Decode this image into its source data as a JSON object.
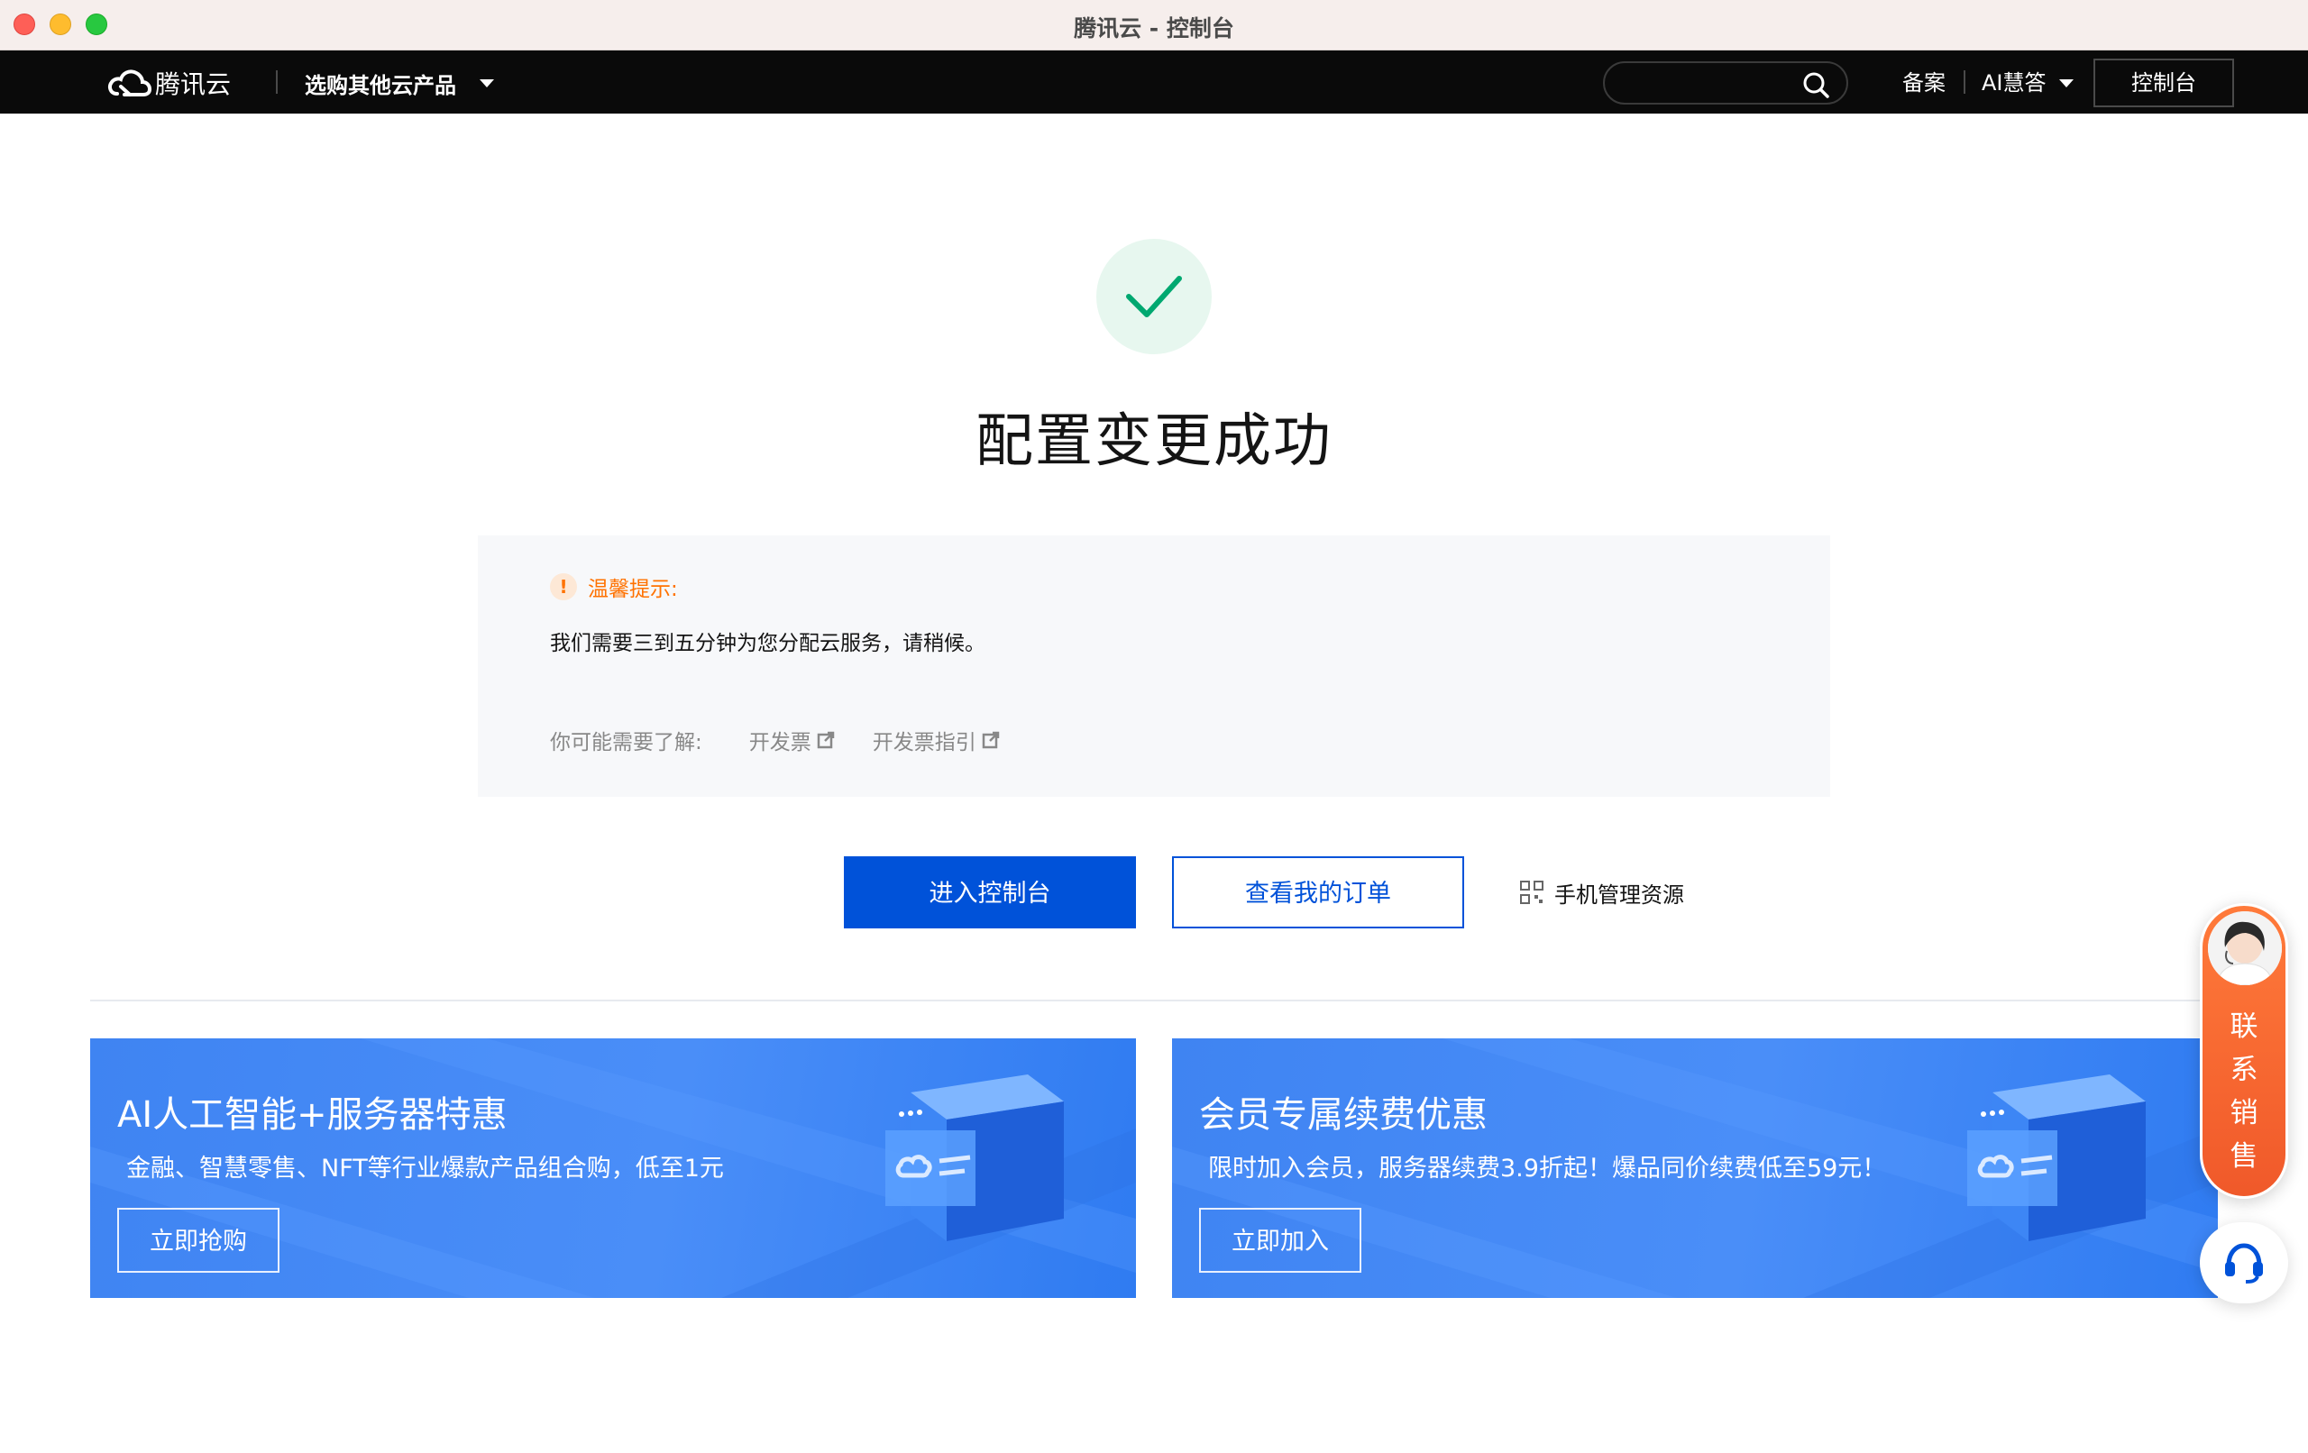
{
  "window": {
    "title": "腾讯云 - 控制台"
  },
  "topnav": {
    "logo_text": "腾讯云",
    "product_menu": "选购其他云产品",
    "search_placeholder": "",
    "beian": "备案",
    "ai_answer": "AI慧答",
    "console": "控制台"
  },
  "success": {
    "title": "配置变更成功"
  },
  "tip": {
    "title": "温馨提示:",
    "text": "我们需要三到五分钟为您分配云服务，请稍候。",
    "more_label": "你可能需要了解:",
    "links": [
      "开发票",
      "开发票指引"
    ]
  },
  "actions": {
    "primary": "进入控制台",
    "secondary": "查看我的订单",
    "mobile": "手机管理资源"
  },
  "banners": [
    {
      "title": "AI人工智能+服务器特惠",
      "subtitle": "金融、智慧零售、NFT等行业爆款产品组合购，低至1元",
      "button": "立即抢购"
    },
    {
      "title": "会员专属续费优惠",
      "subtitle": "限时加入会员，服务器续费3.9折起！爆品同价续费低至59元！",
      "button": "立即加入"
    }
  ],
  "contact": {
    "chars": [
      "联",
      "系",
      "销",
      "售"
    ]
  },
  "colors": {
    "brand_blue": "#0052d9",
    "success_green": "#00a870",
    "warning_orange": "#ff7200",
    "nav_black": "#0a0a0a"
  }
}
